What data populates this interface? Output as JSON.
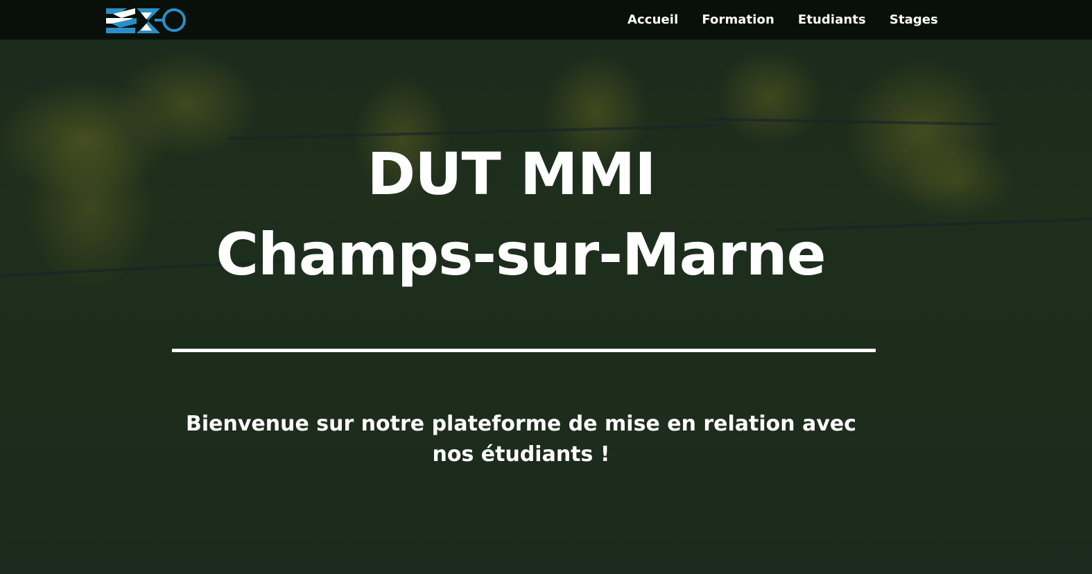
{
  "brand": {
    "logo_icon": "mmi-logo-icon",
    "accent_color": "#2a8fc8"
  },
  "nav": {
    "items": [
      {
        "label": "Accueil"
      },
      {
        "label": "Formation"
      },
      {
        "label": "Etudiants"
      },
      {
        "label": "Stages"
      }
    ]
  },
  "hero": {
    "title_line1": "DUT MMI",
    "title_line2": "Champs-sur-Marne",
    "subtitle": "Bienvenue sur notre plateforme de mise en relation avec nos étudiants !"
  },
  "colors": {
    "navbar_bg": "#0a110a",
    "text": "#ffffff"
  }
}
